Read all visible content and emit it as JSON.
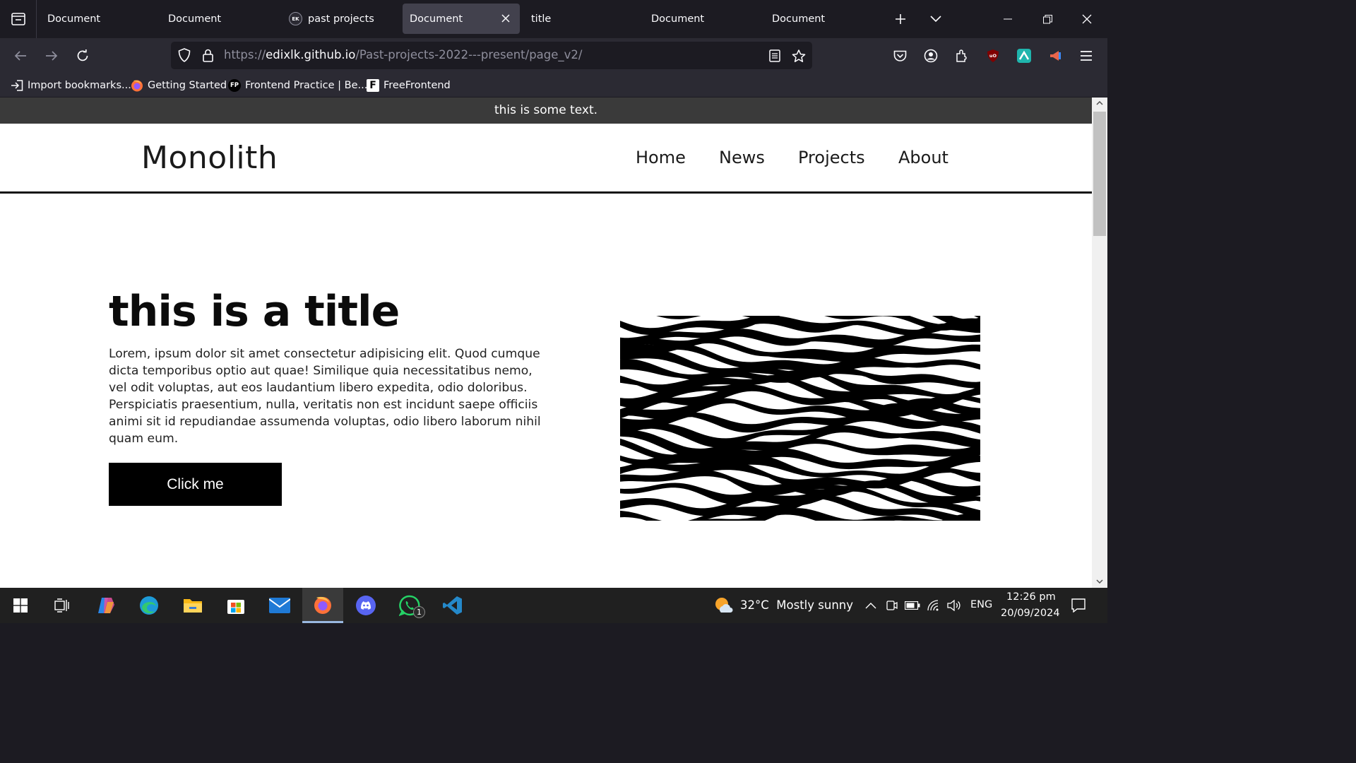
{
  "browser": {
    "tabs": [
      {
        "label": "Document",
        "favicon": "",
        "active": false
      },
      {
        "label": "Document",
        "favicon": "",
        "active": false
      },
      {
        "label": "past projects",
        "favicon": "EK",
        "active": false
      },
      {
        "label": "Document",
        "favicon": "",
        "active": true
      },
      {
        "label": "title",
        "favicon": "",
        "active": false
      },
      {
        "label": "Document",
        "favicon": "",
        "active": false
      },
      {
        "label": "Document",
        "favicon": "",
        "active": false
      }
    ],
    "url": {
      "scheme": "https://",
      "host": "edixlk.github.io",
      "path": "/Past-projects-2022---present/page_v2/"
    },
    "bookmarks": [
      {
        "label": "Import bookmarks...",
        "icon": "import-icon"
      },
      {
        "label": "Getting Started",
        "icon": "firefox-icon"
      },
      {
        "label": "Frontend Practice | Be...",
        "icon": "fp-icon",
        "icon_text": "FP"
      },
      {
        "label": "FreeFrontend",
        "icon": "ff-icon",
        "icon_text": "F"
      }
    ]
  },
  "page": {
    "announcement": "this is some text.",
    "logo": "Monolith",
    "nav": [
      "Home",
      "News",
      "Projects",
      "About"
    ],
    "hero": {
      "title": "this is a title",
      "body": "Lorem, ipsum dolor sit amet consectetur adipisicing elit. Quod cumque dicta temporibus optio aut quae! Similique quia necessitatibus nemo, vel odit voluptas, aut eos laudantium libero expedita, odio doloribus. Perspiciatis praesentium, nulla, veritatis non est incidunt saepe officiis animi sit id repudiandae assumenda voluptas, odio libero laborum nihil quam eum.",
      "button": "Click me"
    }
  },
  "taskbar": {
    "weather": {
      "temp": "32°C",
      "condition": "Mostly sunny"
    },
    "language": "ENG",
    "time": "12:26 pm",
    "date": "20/09/2024",
    "whatsapp_badge": "1"
  },
  "colors": {
    "tabbar_bg": "#1c1b22",
    "toolbar_bg": "#2b2a33",
    "active_tab": "#42414d",
    "announcement_bg": "#3a3a3a",
    "taskbar_bg": "#202020"
  }
}
